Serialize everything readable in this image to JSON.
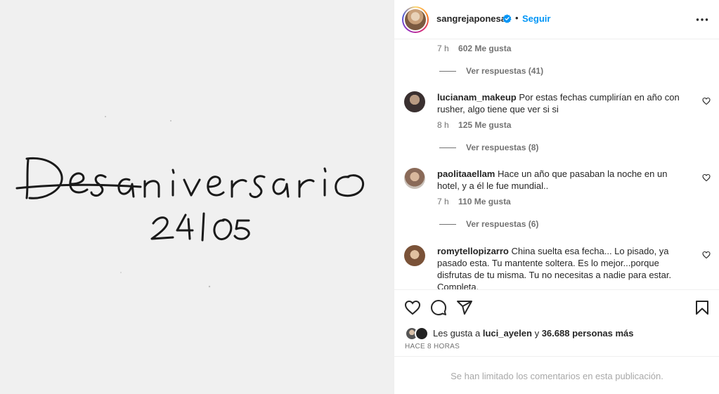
{
  "post": {
    "handwriting_line1": "Desaniversario",
    "handwriting_line2": "24|05"
  },
  "header": {
    "username": "sangrejaponesa",
    "separator": "•",
    "follow_label": "Seguir"
  },
  "top_comment_meta": {
    "time": "7 h",
    "likes": "602 Me gusta"
  },
  "top_comment_replies": "Ver respuestas (41)",
  "comments": [
    {
      "user": "lucianam_makeup",
      "text": "Por estas fechas cumplirían en año con rusher, algo tiene que ver si si",
      "time": "8 h",
      "likes": "125 Me gusta",
      "replies": "Ver respuestas (8)"
    },
    {
      "user": "paolitaaellam",
      "text": "Hace un año que pasaban la noche en un hotel, y a él le fue mundial..",
      "time": "7 h",
      "likes": "110 Me gusta",
      "replies": "Ver respuestas (6)"
    },
    {
      "user": "romytellopizarro",
      "text": "China suelta esa fecha... Lo pisado, ya pasado esta. Tu mantente soltera. Es lo mejor...porque disfrutas de tu misma. Tu no necesitas a nadie para estar. Completa."
    }
  ],
  "likes": {
    "prefix": "Les gusta a",
    "user": "luci_ayelen",
    "connector": "y",
    "others": "36.688 personas más"
  },
  "time_ago": "HACE 8 HORAS",
  "comments_limited": "Se han limitado los comentarios en esta publicación.",
  "icons": {
    "like": "heart-icon",
    "comment": "comment-icon",
    "share": "send-icon",
    "save": "bookmark-icon",
    "more": "more-options-icon",
    "verified": "verified-badge-icon"
  },
  "colors": {
    "link_blue": "#0095f6",
    "muted": "#737373",
    "text": "#262626",
    "verified": "#0095f6"
  }
}
